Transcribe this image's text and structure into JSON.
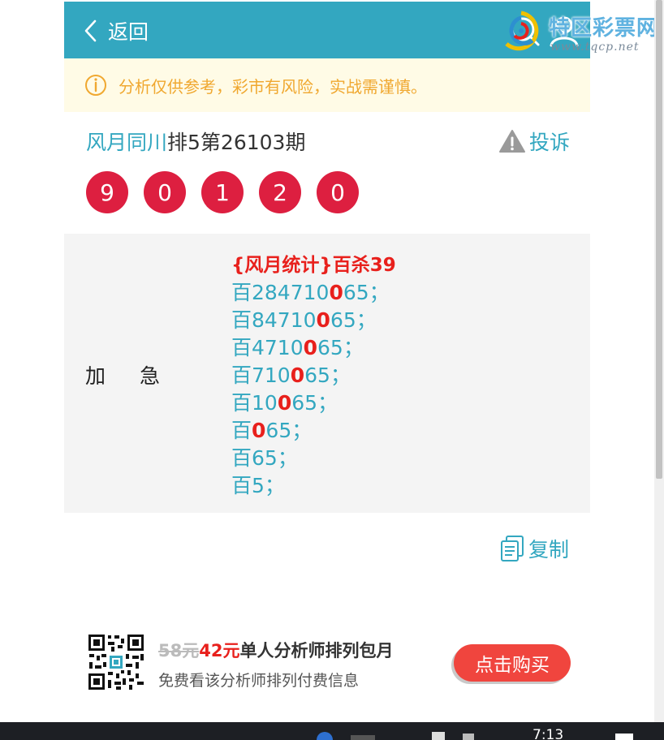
{
  "header": {
    "back_label": "返回",
    "watermark_title": "特区彩票网",
    "watermark_url": "www.tqcp.net"
  },
  "notice": {
    "text": "分析仅供参考，彩市有风险，实战需谨慎。"
  },
  "title_row": {
    "author": "风月同川",
    "issue": "排5第26103期",
    "complaint_label": "投诉"
  },
  "balls": [
    "9",
    "0",
    "1",
    "2",
    "0"
  ],
  "panel": {
    "label": "加急",
    "heading": "{风月统计}百杀39",
    "lines": [
      {
        "before": "百284710",
        "hl": "0",
        "after": "65；"
      },
      {
        "before": "百84710",
        "hl": "0",
        "after": "65；"
      },
      {
        "before": "百4710",
        "hl": "0",
        "after": "65；"
      },
      {
        "before": "百710",
        "hl": "0",
        "after": "65；"
      },
      {
        "before": "百10",
        "hl": "0",
        "after": "65；"
      },
      {
        "before": "百",
        "hl": "0",
        "after": "65；"
      },
      {
        "before": "百65；",
        "hl": "",
        "after": ""
      },
      {
        "before": "百5；",
        "hl": "",
        "after": ""
      }
    ]
  },
  "copy_label": "复制",
  "promo": {
    "price_old": "58元",
    "price_new": "42元",
    "title": "单人分析师排列包月",
    "subtitle": "免费看该分析师排列付费信息",
    "buy_label": "点击购买"
  },
  "taskbar": {
    "clock": "7:13"
  },
  "colors": {
    "header_bg": "#33a7c0",
    "accent": "#33a7c0",
    "ball_red": "#dd1f40",
    "highlight_red": "#e8201c",
    "notice_bg": "#fffbe6",
    "notice_text": "#f0a830",
    "buy_button": "#f0453e"
  }
}
